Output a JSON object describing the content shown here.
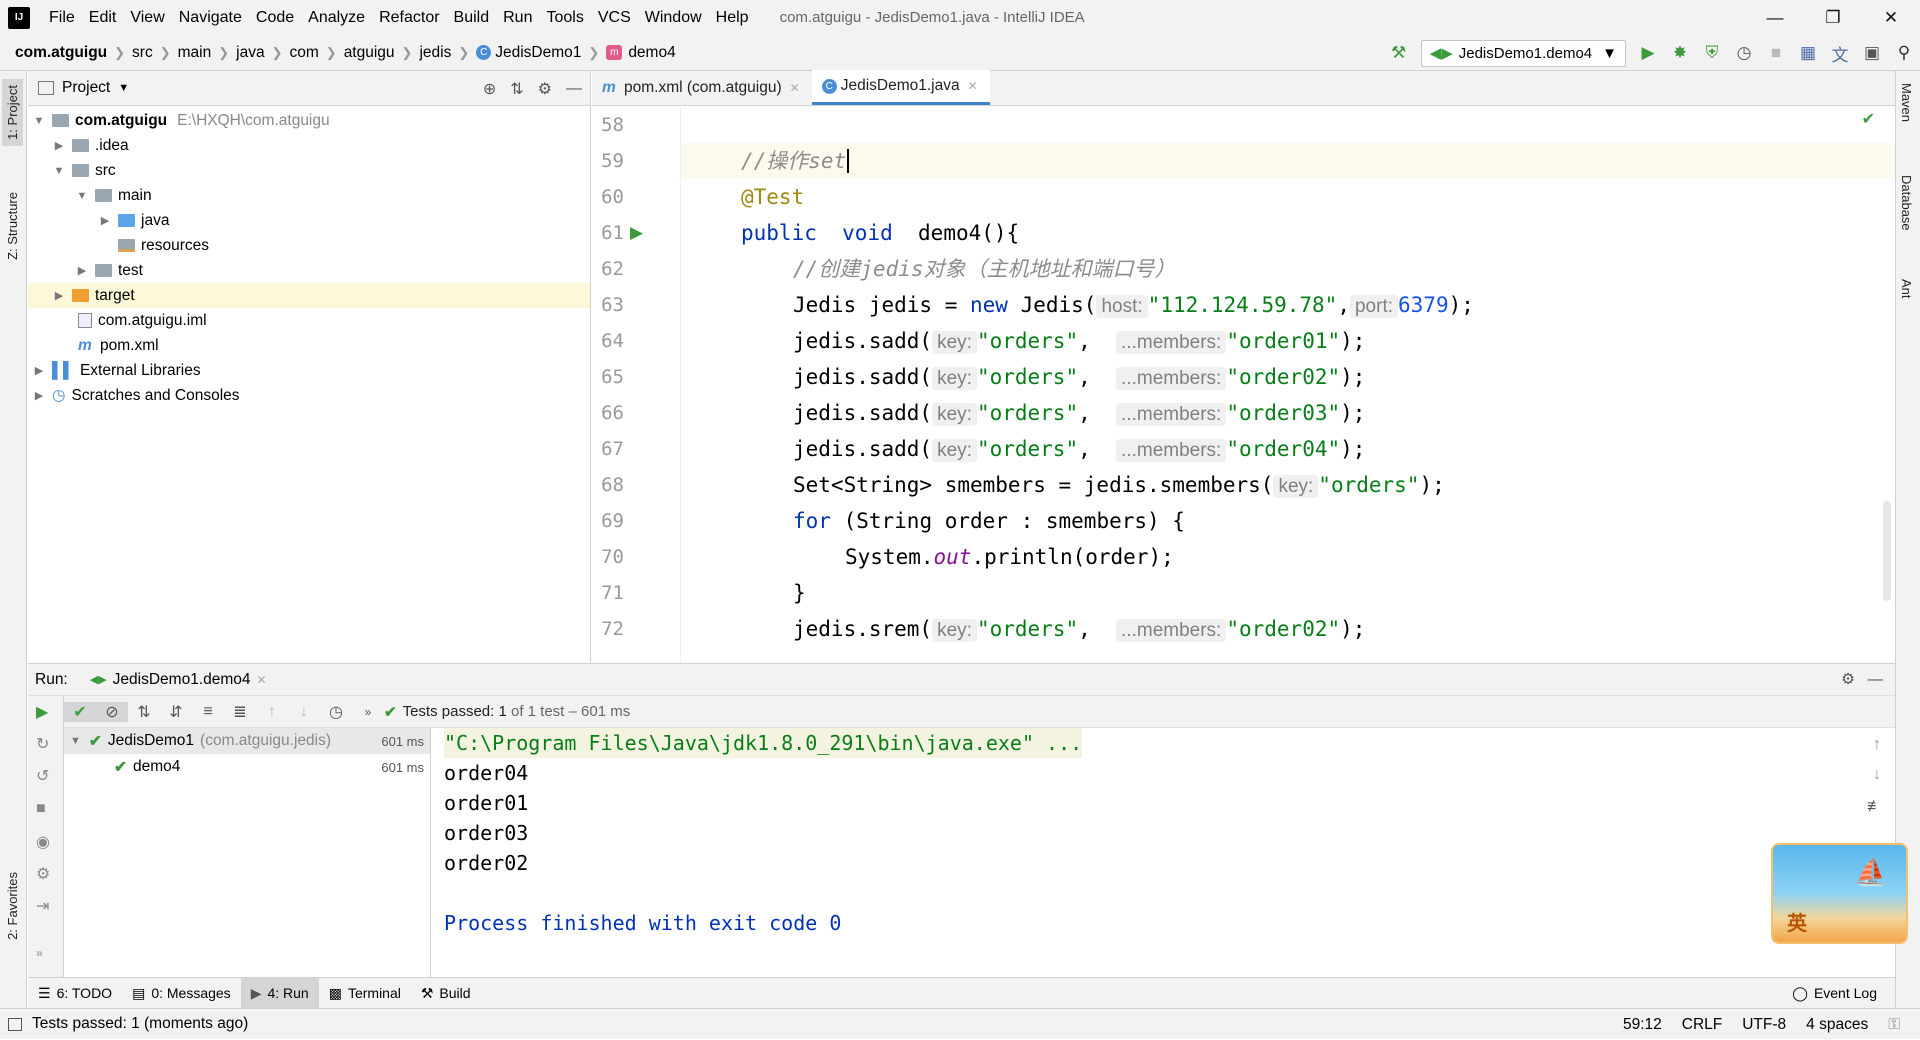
{
  "window": {
    "app_icon_text": "IJ",
    "menu": [
      "File",
      "Edit",
      "View",
      "Navigate",
      "Code",
      "Analyze",
      "Refactor",
      "Build",
      "Run",
      "Tools",
      "VCS",
      "Window",
      "Help"
    ],
    "title": "com.atguigu - JedisDemo1.java - IntelliJ IDEA"
  },
  "breadcrumbs": [
    "com.atguigu",
    "src",
    "main",
    "java",
    "com",
    "atguigu",
    "jedis",
    "JedisDemo1",
    "demo4"
  ],
  "run_config": "JedisDemo1.demo4",
  "left_tool_tabs": [
    "1: Project",
    "Z: Structure",
    "2: Favorites"
  ],
  "right_tool_tabs": [
    "Maven",
    "Database",
    "Ant"
  ],
  "project_panel": {
    "title": "Project",
    "tree": [
      {
        "label": "com.atguigu",
        "path": "E:\\HXQH\\com.atguigu",
        "indent": 0,
        "type": "module",
        "expanded": true
      },
      {
        "label": ".idea",
        "indent": 1,
        "type": "folder",
        "expanded": false
      },
      {
        "label": "src",
        "indent": 1,
        "type": "folder",
        "expanded": true
      },
      {
        "label": "main",
        "indent": 2,
        "type": "folder",
        "expanded": true
      },
      {
        "label": "java",
        "indent": 3,
        "type": "folder-blue",
        "expanded": false
      },
      {
        "label": "resources",
        "indent": 3,
        "type": "folder-res"
      },
      {
        "label": "test",
        "indent": 2,
        "type": "folder",
        "expanded": false
      },
      {
        "label": "target",
        "indent": 1,
        "type": "folder-orange",
        "expanded": false
      },
      {
        "label": "com.atguigu.iml",
        "indent": 1,
        "type": "file"
      },
      {
        "label": "pom.xml",
        "indent": 1,
        "type": "maven"
      },
      {
        "label": "External Libraries",
        "indent": 0,
        "type": "lib",
        "expanded": false
      },
      {
        "label": "Scratches and Consoles",
        "indent": 0,
        "type": "scratch",
        "expanded": false
      }
    ]
  },
  "editor_tabs": [
    {
      "label": "pom.xml (com.atguigu)",
      "active": false
    },
    {
      "label": "JedisDemo1.java",
      "active": true
    }
  ],
  "code_lines": [
    {
      "n": "58"
    },
    {
      "n": "59"
    },
    {
      "n": "60"
    },
    {
      "n": "61"
    },
    {
      "n": "62"
    },
    {
      "n": "63"
    },
    {
      "n": "64"
    },
    {
      "n": "65"
    },
    {
      "n": "66"
    },
    {
      "n": "67"
    },
    {
      "n": "68"
    },
    {
      "n": "69"
    },
    {
      "n": "70"
    },
    {
      "n": "71"
    },
    {
      "n": "72"
    }
  ],
  "code": {
    "c59": "//操作set",
    "c60": "@Test",
    "c61_kw1": "public",
    "c61_kw2": "void",
    "c61_rest": "demo4(){",
    "c62": "//创建jedis对象（主机地址和端口号）",
    "c63_a": "Jedis jedis = ",
    "c63_new": "new",
    "c63_b": " Jedis(",
    "c63_hint_host": "host:",
    "c63_str": "\"112.124.59.78\"",
    "c63_hint_port": "port:",
    "c63_num": "6379",
    "c63_end": ");",
    "sadd_prefix": "jedis.sadd(",
    "hint_key": "key:",
    "hint_members": "...members:",
    "orders_str": "\"orders\"",
    "sadd_args": [
      "\"order01\"",
      "\"order02\"",
      "\"order03\"",
      "\"order04\""
    ],
    "end": ");",
    "c68_a": "Set<String> smembers = jedis.smembers(",
    "c69_kw": "for",
    "c69_rest": " (String order : smembers) {",
    "c70_a": "System.",
    "c70_out": "out",
    "c70_b": ".println(order);",
    "c71": "}",
    "c72_a": "jedis.srem(",
    "c72_arg": "\"order02\""
  },
  "run_panel": {
    "label": "Run:",
    "tab": "JedisDemo1.demo4",
    "tests_passed_prefix": "Tests passed:",
    "tests_passed_value": "1",
    "tests_passed_suffix": "of 1 test – 601 ms",
    "tree": [
      {
        "label": "JedisDemo1",
        "sub": "(com.atguigu.jedis)",
        "time": "601 ms"
      },
      {
        "label": "demo4",
        "time": "601 ms"
      }
    ],
    "console": [
      "\"C:\\Program Files\\Java\\jdk1.8.0_291\\bin\\java.exe\" ...",
      "order04",
      "order01",
      "order03",
      "order02",
      "",
      "Process finished with exit code 0"
    ]
  },
  "bottom_tabs": [
    "6: TODO",
    "0: Messages",
    "4: Run",
    "Terminal",
    "Build"
  ],
  "event_log": "Event Log",
  "status": {
    "message": "Tests passed: 1 (moments ago)",
    "position": "59:12",
    "line_sep": "CRLF",
    "encoding": "UTF-8",
    "indent": "4 spaces"
  },
  "ime_label": "英",
  "colors": {
    "accent": "#4083c9",
    "keyword": "#0033b3",
    "string": "#067d17",
    "number": "#1750eb",
    "comment": "#8c8c8c",
    "pass": "#3c9a3c"
  }
}
